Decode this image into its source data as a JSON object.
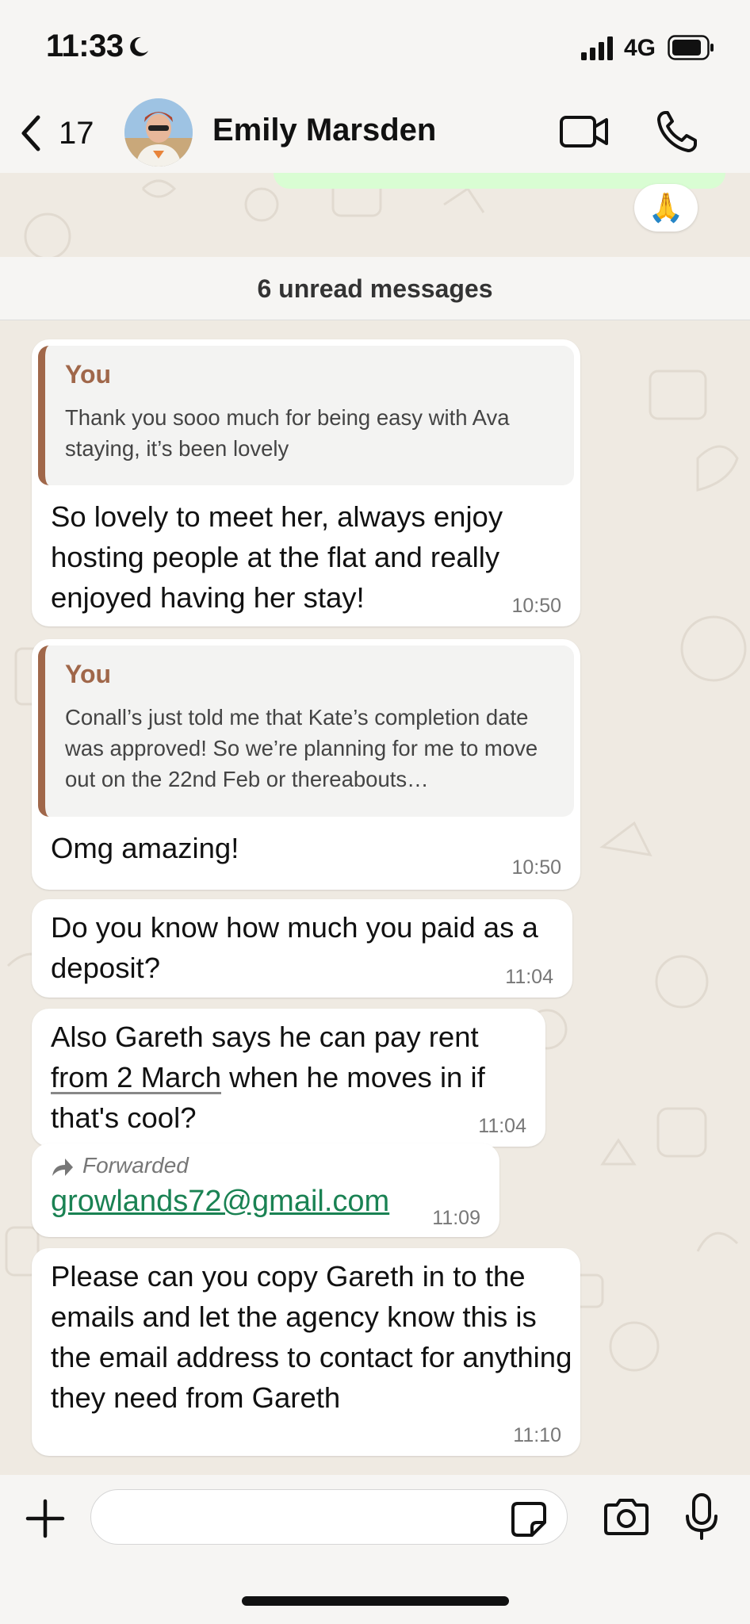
{
  "status_bar": {
    "time": "11:33",
    "network": "4G"
  },
  "header": {
    "back_count": "17",
    "contact_name": "Emily Marsden"
  },
  "chat": {
    "reaction_emoji": "🙏",
    "unread_banner": "6 unread messages",
    "messages": [
      {
        "quote_author": "You",
        "quote_text": "Thank you sooo much for being easy with Ava staying, it’s been lovely",
        "text": "So lovely to meet her, always enjoy hosting people at the flat and really enjoyed having her stay!",
        "time": "10:50"
      },
      {
        "quote_author": "You",
        "quote_text": "Conall’s just told me that Kate’s completion date was approved! So we’re planning for me to move out on the 22nd Feb or thereabouts…",
        "text": "Omg amazing!",
        "time": "10:50"
      },
      {
        "text": "Do you know how much you paid as a deposit?",
        "time": "11:04"
      },
      {
        "text_before": "Also Gareth says he can pay rent",
        "date_link": "from 2 March",
        "text_after": "when he moves in if that's cool?",
        "time": "11:04"
      },
      {
        "forwarded_label": "Forwarded",
        "email": "growlands72@gmail.com",
        "time": "11:09"
      },
      {
        "text": "Please can you copy Gareth in to the emails and let the agency know this is the email address to contact for anything they need from Gareth",
        "time": "11:10"
      }
    ]
  },
  "input": {
    "placeholder": ""
  },
  "colors": {
    "quote_accent": "#a0674a",
    "link_green": "#1a8253",
    "chat_background": "#efeae2",
    "outgoing_bubble": "#d9fdd3"
  }
}
